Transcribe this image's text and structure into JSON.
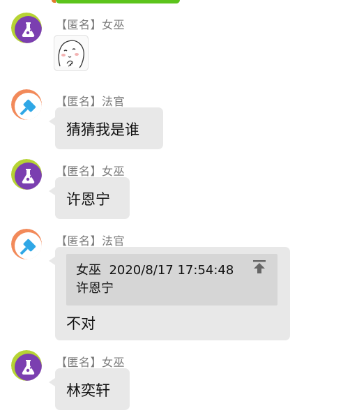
{
  "colors": {
    "bubble": "#e8e8e8",
    "quote_box": "#d6d6d6",
    "sender_text": "#7a7a7a",
    "witch_avatar_ring": "#b6d334",
    "witch_avatar_fill": "#7b3fb0",
    "judge_avatar_ring": "#f28a5a",
    "judge_avatar_fill": "#2fa7e6",
    "top_bar": "#5cc41c"
  },
  "messages": [
    {
      "sender": "【匿名】女巫",
      "avatar_icon": "flask-icon",
      "type": "sticker",
      "sticker_icon": "shy-bun-sticker"
    },
    {
      "sender": "【匿名】法官",
      "avatar_icon": "gavel-icon",
      "type": "text",
      "text": "猜猜我是谁"
    },
    {
      "sender": "【匿名】女巫",
      "avatar_icon": "flask-icon",
      "type": "text",
      "text": "许恩宁"
    },
    {
      "sender": "【匿名】法官",
      "avatar_icon": "gavel-icon",
      "type": "reply",
      "quote": {
        "author": "女巫",
        "timestamp": "2020/8/17 17:54:48",
        "text": "许恩宁",
        "jump_icon": "jump-to-top-icon"
      },
      "text": "不对"
    },
    {
      "sender": "【匿名】女巫",
      "avatar_icon": "flask-icon",
      "type": "text",
      "text": "林奕轩"
    }
  ]
}
